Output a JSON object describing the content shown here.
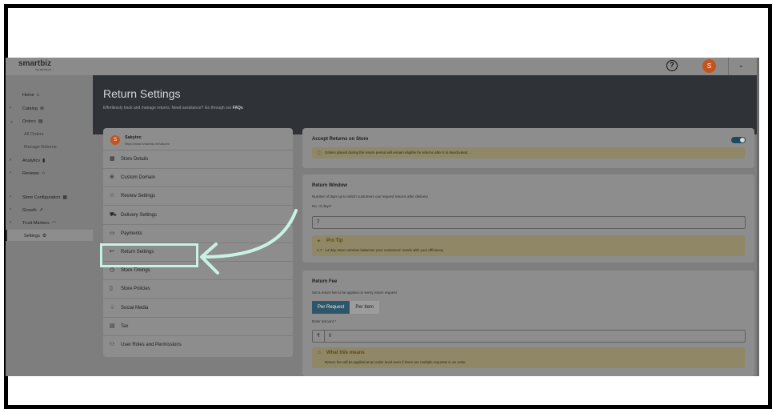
{
  "topbar": {
    "logo": "smartbiz",
    "logo_sub": "by amazon",
    "avatar_initial": "S"
  },
  "sidebar": {
    "items": [
      {
        "label": "Home",
        "icon": "home-icon",
        "glyph": "⌂",
        "arrow": ""
      },
      {
        "label": "Catalog",
        "icon": "catalog-icon",
        "glyph": "⊛",
        "arrow": "›"
      },
      {
        "label": "Orders",
        "icon": "orders-icon",
        "glyph": "▤",
        "arrow": "⌄"
      },
      {
        "label": "All Orders",
        "sub": true
      },
      {
        "label": "Manage Returns",
        "sub": true,
        "badge": "NEW"
      },
      {
        "label": "Analytics",
        "icon": "analytics-icon",
        "glyph": "▮",
        "arrow": "›"
      },
      {
        "label": "Reviews",
        "icon": "star-icon",
        "glyph": "☆",
        "arrow": "›"
      },
      {
        "label": "Store Configuration",
        "icon": "config-icon",
        "glyph": "▦",
        "arrow": "›"
      },
      {
        "label": "Growth",
        "icon": "growth-icon",
        "glyph": "↗",
        "arrow": "›"
      },
      {
        "label": "Trust Markers",
        "icon": "wifi-icon",
        "glyph": "◠",
        "arrow": "›"
      },
      {
        "label": "Settings",
        "icon": "gear-icon",
        "glyph": "⚙",
        "arrow": "",
        "active": true
      }
    ]
  },
  "hero": {
    "title": "Return Settings",
    "subtitle": "Effortlessly track and manage returns. Need assistance? Go through our",
    "faq_link": "FAQs"
  },
  "store": {
    "initial": "S",
    "name": "Sakyinc",
    "url": "https://www.smartbiz.in/Sakyinc"
  },
  "settings_menu": [
    {
      "label": "Store Details",
      "icon": "store-icon",
      "glyph": "▦"
    },
    {
      "label": "Custom Domain",
      "icon": "globe-icon",
      "glyph": "⊕"
    },
    {
      "label": "Review Settings",
      "icon": "star-icon",
      "glyph": "☆"
    },
    {
      "label": "Delivery Settings",
      "icon": "truck-icon",
      "glyph": "⛟"
    },
    {
      "label": "Payments",
      "icon": "payments-icon",
      "glyph": "▭"
    },
    {
      "label": "Return Settings",
      "icon": "return-icon",
      "glyph": "↩"
    },
    {
      "label": "Store Timings",
      "icon": "clock-icon",
      "glyph": "◷"
    },
    {
      "label": "Store Policies",
      "icon": "policy-icon",
      "glyph": "▯"
    },
    {
      "label": "Social Media",
      "icon": "social-icon",
      "glyph": "♧"
    },
    {
      "label": "Tax",
      "icon": "tax-icon",
      "glyph": "▤"
    },
    {
      "label": "User Roles and Permissions",
      "icon": "users-icon",
      "glyph": "⚇"
    }
  ],
  "accept_returns": {
    "title": "Accept Returns on Store",
    "enabled": true,
    "note": "Orders placed during the return period will remain eligible for returns after it is deactivated."
  },
  "return_window": {
    "title": "Return Window",
    "description": "Number of days up to which customers can request returns after delivery",
    "field_label": "No. of days*",
    "value": "7",
    "tip_title": "Pro Tip",
    "tip_text": "A 7 - 14 day return window balances your customers' needs with your efficiency"
  },
  "return_fee": {
    "title": "Return Fee",
    "description": "Set a return fee to be applied on every return request",
    "options": [
      "Per Request",
      "Per Item"
    ],
    "selected": "Per Request",
    "field_label": "Enter amount *",
    "currency": "₹",
    "value": "0",
    "info_title": "What this means",
    "info_text": "Return fee will be applied at an order level even if there are multiple requests in an order"
  },
  "colors": {
    "hero_bg": "#2f3337",
    "highlight": "#c8f3e3",
    "accent": "#2d566b",
    "avatar": "#c4541f"
  }
}
